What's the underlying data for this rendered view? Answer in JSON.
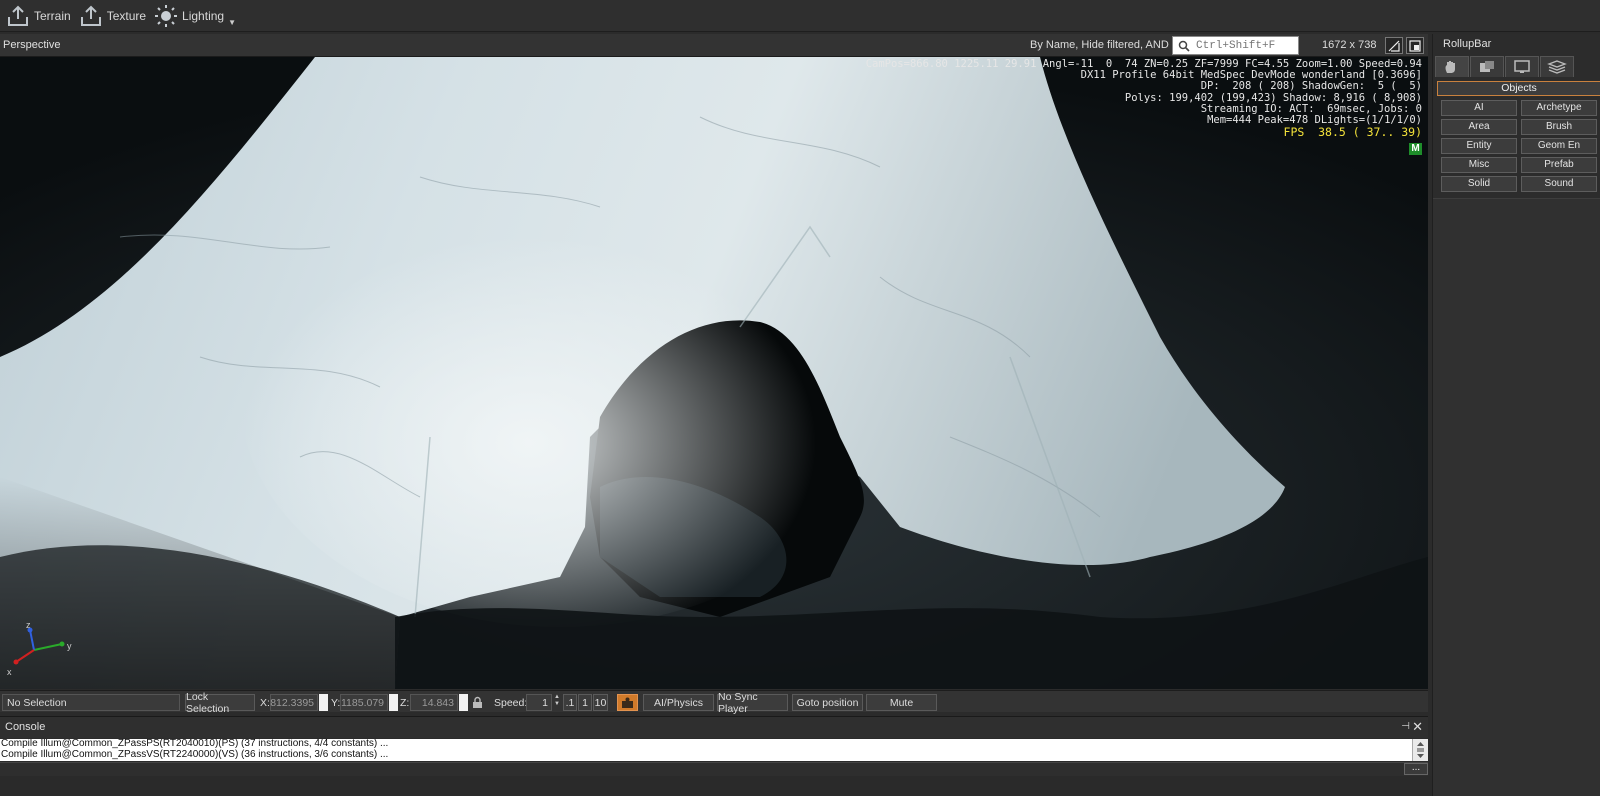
{
  "toolbar": {
    "items": [
      {
        "label": "Terrain",
        "icon": "terrain-export-icon"
      },
      {
        "label": "Texture",
        "icon": "texture-export-icon"
      },
      {
        "label": "Lighting",
        "icon": "sun-icon"
      }
    ]
  },
  "viewport": {
    "title": "Perspective",
    "filter_text": "By Name, Hide filtered, AND",
    "search_placeholder": "Ctrl+Shift+F",
    "resolution": "1672 x 738",
    "stats": {
      "line1": "CamPos=866.80 1225.11 29.91 Angl=-11  0  74 ZN=0.25 ZF=7999 FC=4.55 Zoom=1.00 Speed=0.94",
      "line2": "DX11 Profile 64bit MedSpec DevMode wonderland [0.3696]",
      "line3": "DP:  208 ( 208) ShadowGen:  5 (  5)",
      "line4": "Polys: 199,402 (199,423) Shadow: 8,916 ( 8,908)",
      "line5": "Streaming IO: ACT:  69msec, Jobs: 0",
      "line6": "Mem=444 Peak=478 DLights=(1/1/1/0)",
      "fps": "FPS  38.5 ( 37.. 39)"
    },
    "badge": "M",
    "axis_labels": {
      "z": "z",
      "y": "y",
      "x": "x"
    }
  },
  "statusbar": {
    "selection": "No Selection",
    "lock_selection": "Lock Selection",
    "x_label": "X:",
    "x_value": "812.3395",
    "y_label": "Y:",
    "y_value": "1185.079",
    "z_label": "Z:",
    "z_value": "14.843",
    "speed_label": "Speed:",
    "speed_value": "1",
    "speed_presets": [
      ".1",
      "1",
      "10"
    ],
    "ai_physics": "AI/Physics",
    "no_sync_player": "No Sync Player",
    "goto_position": "Goto position",
    "mute": "Mute"
  },
  "console": {
    "title": "Console",
    "lines": [
      "Compile Illum@Common_ZPassPS(RT2040010)(PS) (37 instructions, 4/4 constants) ...",
      "Compile Illum@Common_ZPassVS(RT2240000)(VS) (36 instructions, 3/6 constants) ..."
    ],
    "more_button": "..."
  },
  "rollup": {
    "title": "RollupBar",
    "tabs": [
      "objects-tab-icon",
      "modify-tab-icon",
      "display-tab-icon",
      "layers-tab-icon"
    ],
    "section": "Objects",
    "buttons_left": [
      "AI",
      "Area",
      "Entity",
      "Misc",
      "Solid"
    ],
    "buttons_right": [
      "Archetype",
      "Brush",
      "Geom En",
      "Prefab",
      "Sound"
    ]
  },
  "colors": {
    "fps": "#f3e23a",
    "badge": "#1e8d2a",
    "section_border": "#c9813e"
  }
}
